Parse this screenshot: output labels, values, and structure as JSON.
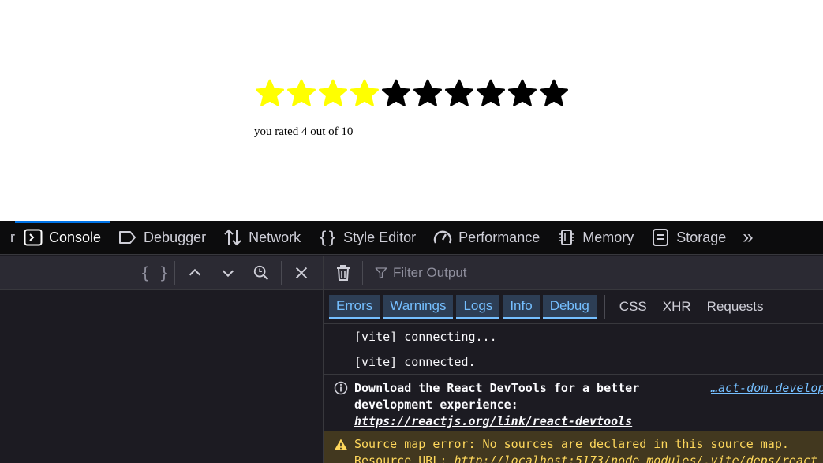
{
  "rating": {
    "value": 4,
    "max": 10,
    "filled_color": "#ffff00",
    "empty_color": "#000000",
    "text": "you rated 4 out of 10"
  },
  "devtools": {
    "tabs": [
      {
        "id": "inspector-clipped",
        "label": "r"
      },
      {
        "id": "console",
        "label": "Console",
        "icon": "console-icon",
        "selected": true
      },
      {
        "id": "debugger",
        "label": "Debugger",
        "icon": "debugger-icon"
      },
      {
        "id": "network",
        "label": "Network",
        "icon": "network-icon"
      },
      {
        "id": "style-editor",
        "label": "Style Editor",
        "icon": "style-editor-icon"
      },
      {
        "id": "performance",
        "label": "Performance",
        "icon": "performance-icon"
      },
      {
        "id": "memory",
        "label": "Memory",
        "icon": "memory-icon"
      },
      {
        "id": "storage",
        "label": "Storage",
        "icon": "storage-icon"
      }
    ],
    "more_tabs_glyph": "»",
    "left_toolbar": {
      "pretty_print": "{ }"
    },
    "filter": {
      "placeholder": "Filter Output"
    },
    "levels": [
      "Errors",
      "Warnings",
      "Logs",
      "Info",
      "Debug"
    ],
    "net_filters": [
      "CSS",
      "XHR",
      "Requests"
    ],
    "messages": {
      "m1": "[vite] connecting...",
      "m2": "[vite] connected.",
      "info_text": "Download the React DevTools for a better development experience: ",
      "info_link": "https://reactjs.org/link/react-devtools",
      "info_location": "…act-dom.develop",
      "warn_line1": "Source map error: No sources are declared in this source map.",
      "warn_line2_label": "Resource URL: ",
      "warn_line2_link": "http://localhost:5173/node_modules/.vite/deps/react"
    },
    "accent_color": "#0074e8"
  }
}
